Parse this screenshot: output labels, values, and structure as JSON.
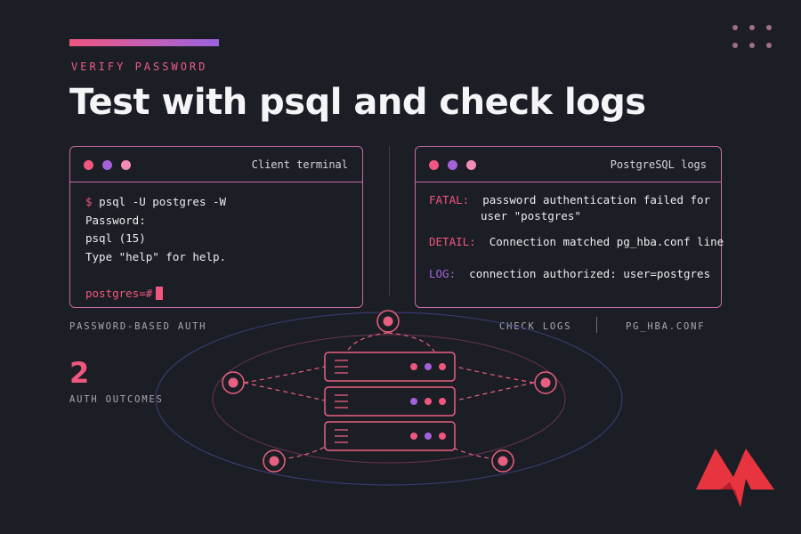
{
  "header": {
    "eyebrow": "VERIFY PASSWORD",
    "title": "Test with psql and check logs"
  },
  "client_panel": {
    "title": "Client terminal",
    "lines": {
      "prompt_symbol": "$",
      "command": "psql -U postgres -W",
      "password": "Password:",
      "version": "psql (15)",
      "help": "Type \"help\" for help.",
      "prompt": "postgres=#"
    }
  },
  "logs_panel": {
    "title": "PostgreSQL logs",
    "fatal_key": "FATAL:",
    "fatal_text_1": "password authentication failed for",
    "fatal_text_2": "user \"postgres\"",
    "detail_key": "DETAIL:",
    "detail_text": "Connection matched pg_hba.conf line",
    "log_key": "LOG:",
    "log_text": "connection authorized: user=postgres"
  },
  "labels": {
    "password_auth": "PASSWORD-BASED AUTH",
    "check_logs": "CHECK LOGS",
    "pg_hba": "PG_HBA.CONF",
    "outcome_count": "2",
    "outcome_label": "AUTH OUTCOMES"
  },
  "colors": {
    "background": "#1c1e25",
    "accent_pink": "#f0567e",
    "accent_purple": "#a561d8",
    "border": "#c86ba4",
    "logo_red": "#e8343f"
  },
  "icons": {
    "server": "server-rack-icon",
    "node": "network-node-icon",
    "logo": "brand-logo"
  }
}
